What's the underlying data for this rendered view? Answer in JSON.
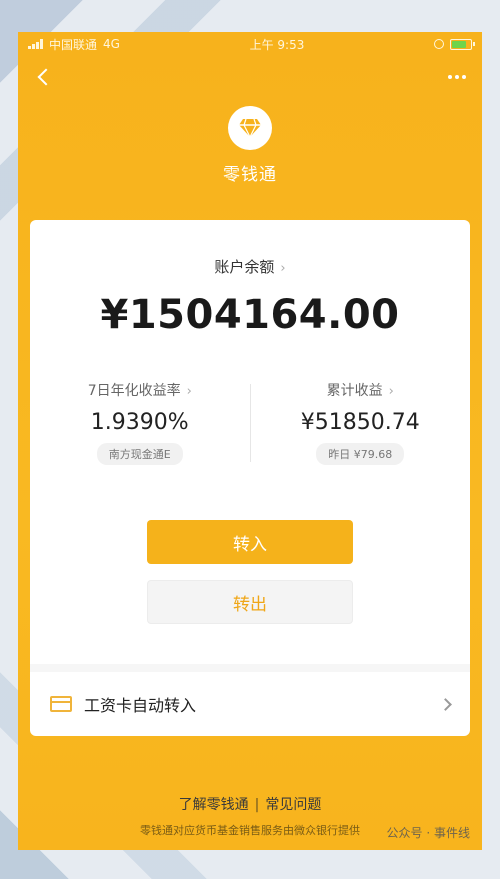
{
  "status_bar": {
    "carrier": "中国联通",
    "network": "4G",
    "time": "上午 9:53"
  },
  "header": {
    "title": "零钱通",
    "logo_icon": "diamond-icon"
  },
  "balance": {
    "label": "账户余额",
    "value": "¥1504164.00"
  },
  "stats": {
    "yield": {
      "label": "7日年化收益率",
      "value": "1.9390%",
      "tag": "南方现金通E"
    },
    "earnings": {
      "label": "累计收益",
      "value": "¥51850.74",
      "tag": "昨日 ¥79.68"
    }
  },
  "actions": {
    "transfer_in": "转入",
    "transfer_out": "转出"
  },
  "salary": {
    "label": "工资卡自动转入"
  },
  "footer": {
    "link_about": "了解零钱通",
    "link_faq": "常见问题",
    "note": "零钱通对应货币基金销售服务由微众银行提供"
  },
  "watermark": "公众号 · 事件线",
  "colors": {
    "brand_yellow": "#f7b21c",
    "button_yellow": "#f5b21b",
    "out_text": "#f0a616"
  }
}
